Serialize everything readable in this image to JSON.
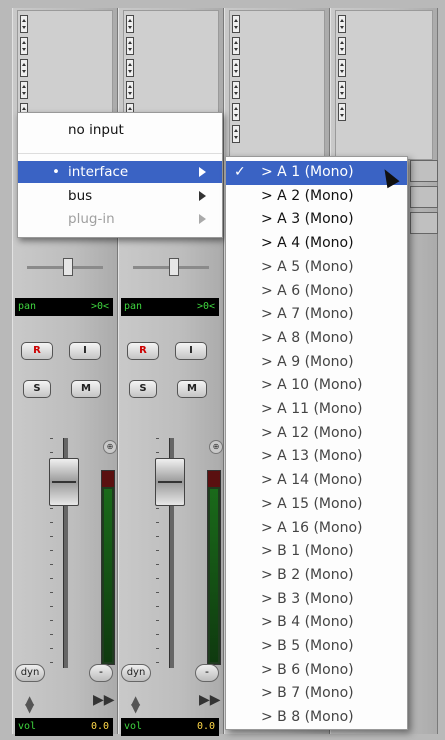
{
  "channel_strips": [
    {
      "pan_label": "pan",
      "pan_value": ">0<",
      "rec": "R",
      "input": "I",
      "solo": "S",
      "mute": "M",
      "dyn": "dyn",
      "dash": "-",
      "vol_label": "vol",
      "vol_value": "0.0"
    },
    {
      "pan_label": "pan",
      "pan_value": ">0<",
      "rec": "R",
      "input": "I",
      "solo": "S",
      "mute": "M",
      "dyn": "dyn",
      "dash": "-",
      "vol_label": "vol",
      "vol_value": "0.0"
    }
  ],
  "fader_symbol": "⊕",
  "input_menu": {
    "items": [
      {
        "label": "no input",
        "state": "normal",
        "submenu": false
      },
      {
        "label": "interface",
        "state": "highlighted",
        "submenu": true,
        "bullet": "•"
      },
      {
        "label": "bus",
        "state": "normal",
        "submenu": true
      },
      {
        "label": "plug-in",
        "state": "disabled",
        "submenu": true
      }
    ]
  },
  "interface_submenu": {
    "checkmark": "✓",
    "items": [
      "> A 1 (Mono)",
      "> A 2 (Mono)",
      "> A 3 (Mono)",
      "> A 4 (Mono)",
      "> A 5 (Mono)",
      "> A 6 (Mono)",
      "> A 7 (Mono)",
      "> A 8 (Mono)",
      "> A 9 (Mono)",
      "> A 10 (Mono)",
      "> A 11 (Mono)",
      "> A 12 (Mono)",
      "> A 13 (Mono)",
      "> A 14 (Mono)",
      "> A 15 (Mono)",
      "> A 16 (Mono)",
      "> B 1 (Mono)",
      "> B 2 (Mono)",
      "> B 3 (Mono)",
      "> B 4 (Mono)",
      "> B 5 (Mono)",
      "> B 6 (Mono)",
      "> B 7 (Mono)",
      "> B 8 (Mono)"
    ],
    "selected_index": 0
  },
  "colors": {
    "highlight": "#3a63c4",
    "display_green": "#3fd43f",
    "display_yellow": "#ffd84a",
    "rec_red": "#cc0000"
  }
}
